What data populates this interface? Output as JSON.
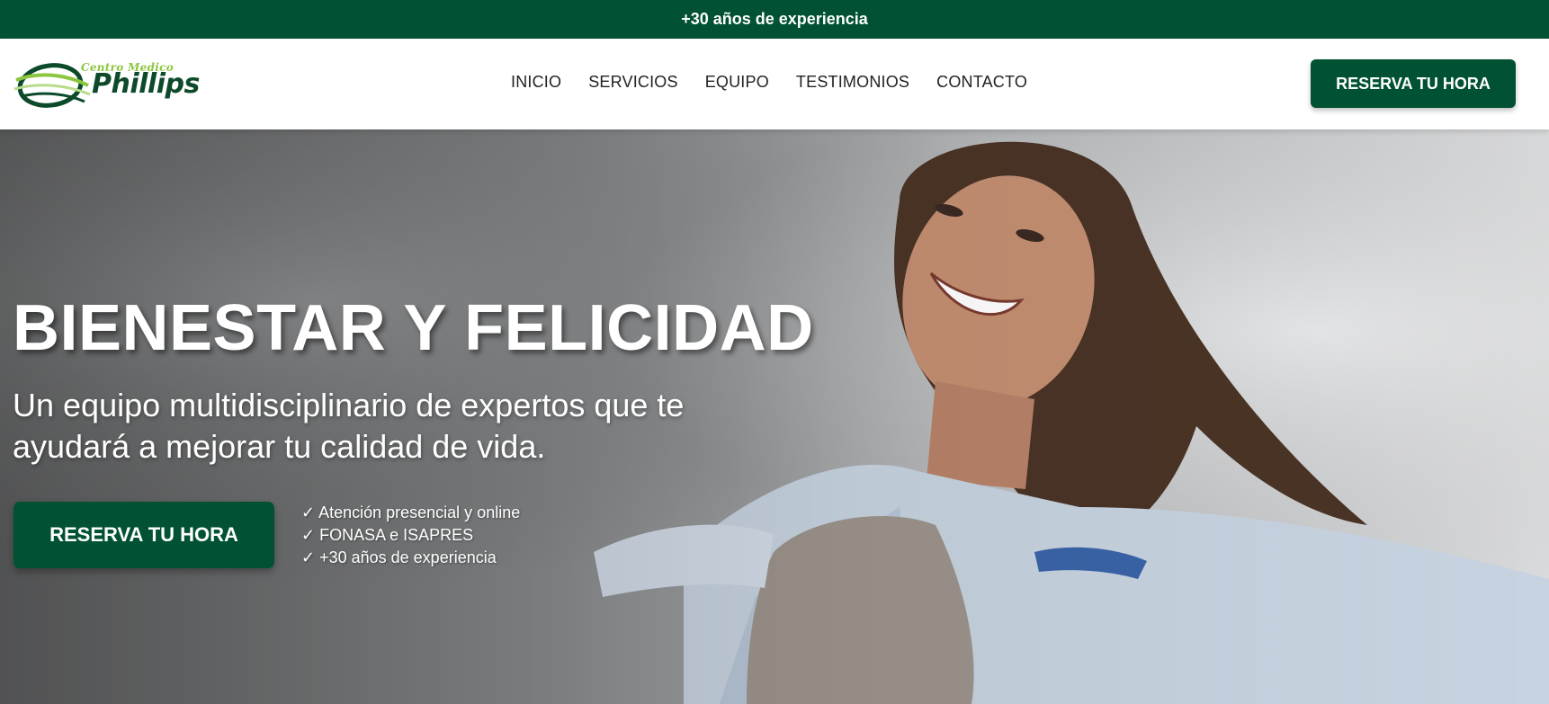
{
  "topbar": {
    "text": "+30 años de experiencia"
  },
  "logo": {
    "small": "Centro Medico",
    "big": "Phillips"
  },
  "nav": {
    "items": [
      {
        "label": "INICIO"
      },
      {
        "label": "SERVICIOS"
      },
      {
        "label": "EQUIPO"
      },
      {
        "label": "TESTIMONIOS"
      },
      {
        "label": "CONTACTO"
      }
    ]
  },
  "header": {
    "cta_label": "RESERVA TU HORA"
  },
  "hero": {
    "title": "BIENESTAR Y FELICIDAD",
    "subtitle": "Un equipo multidisciplinario de expertos que te ayudará a mejorar tu calidad de vida.",
    "cta_label": "RESERVA TU HORA",
    "features": [
      "✓ Atención presencial y online",
      "✓ FONASA e ISAPRES",
      "✓ +30 años de experiencia"
    ],
    "image": "smiling-woman-photo"
  },
  "colors": {
    "brand_green": "#015232",
    "logo_light_green": "#8cc63f",
    "logo_dark_green": "#0c4a2a",
    "white": "#ffffff"
  }
}
